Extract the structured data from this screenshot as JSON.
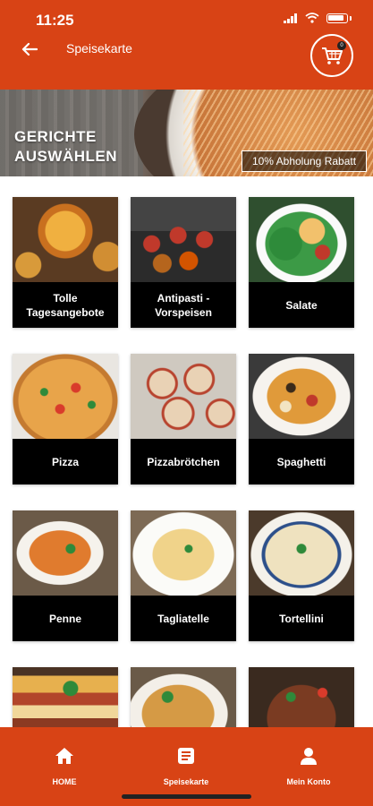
{
  "status": {
    "time": "11:25"
  },
  "appbar": {
    "title": "Speisekarte",
    "cart_count": "0"
  },
  "banner": {
    "title_line1": "GERICHTE",
    "title_line2": "AUSWÄHLEN",
    "badge": "10% Abholung Rabatt"
  },
  "categories": [
    {
      "label": "Tolle Tagesangebote"
    },
    {
      "label": "Antipasti - Vorspeisen"
    },
    {
      "label": "Salate"
    },
    {
      "label": "Pizza"
    },
    {
      "label": "Pizzabrötchen"
    },
    {
      "label": "Spaghetti"
    },
    {
      "label": "Penne"
    },
    {
      "label": "Tagliatelle"
    },
    {
      "label": "Tortellini"
    }
  ],
  "bottom_nav": {
    "home": "HOME",
    "menu": "Speisekarte",
    "account": "Mein Konto"
  },
  "colors": {
    "primary": "#d84315",
    "card_label_bg": "#000000"
  }
}
